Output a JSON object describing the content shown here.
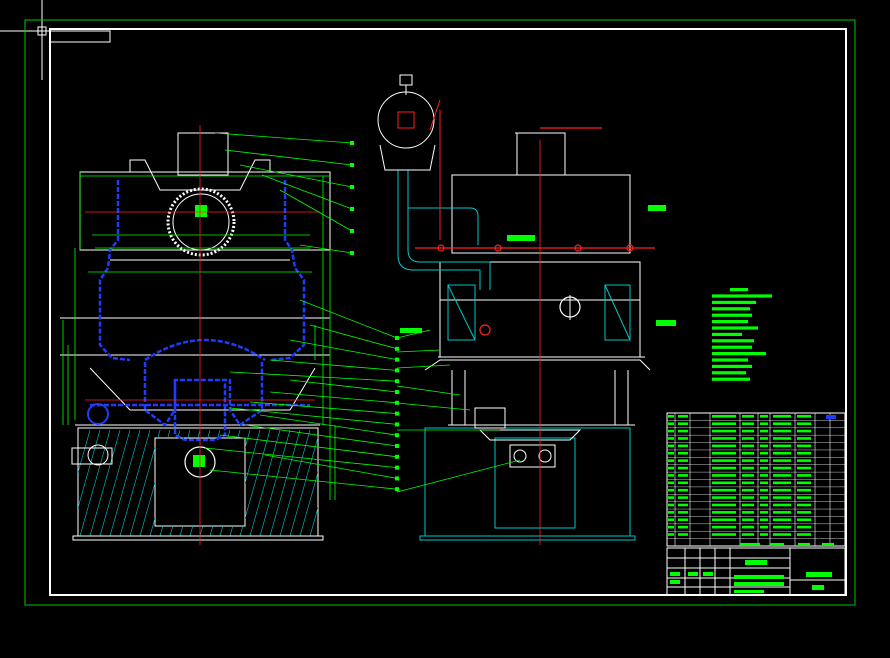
{
  "drawing": {
    "kind": "CAD engineering assembly drawing",
    "views": [
      "front-section-view",
      "side-elevation-view"
    ],
    "colors": {
      "background": "#000000",
      "frame": "#ffffff",
      "outer_border": "#00c800",
      "geometry": "#ffffff",
      "hidden_section": "#1e3cff",
      "dimension": "#00ff00",
      "hatch": "#00c8c8",
      "centerline": "#ff2020",
      "annotation": "#00ff00"
    },
    "balloon_count": {
      "front_view": 21,
      "side_view": 7
    },
    "title_block": {
      "parts_list_rows": 18,
      "legible_text": false
    }
  }
}
